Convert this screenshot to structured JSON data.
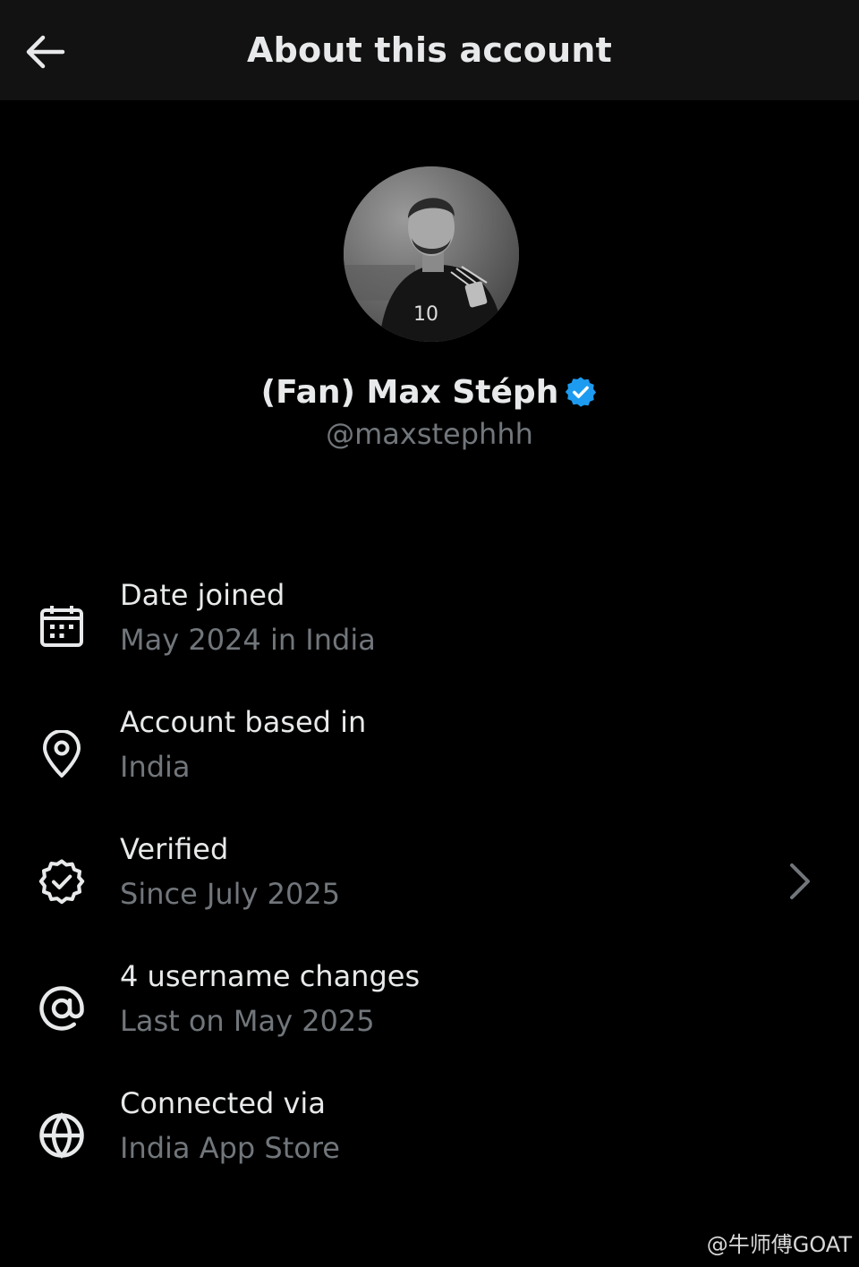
{
  "header": {
    "title": "About this account",
    "back_icon": "arrow-left-icon"
  },
  "profile": {
    "display_name": "(Fan) Max Stéph",
    "handle": "@maxstephhh",
    "verified_badge_color": "#1d9bf0"
  },
  "rows": [
    {
      "icon": "calendar-icon",
      "title": "Date joined",
      "subtitle": "May 2024 in India"
    },
    {
      "icon": "location-pin-icon",
      "title": "Account based in",
      "subtitle": "India"
    },
    {
      "icon": "verified-badge-icon",
      "title": "Verified",
      "subtitle": "Since July 2025",
      "has_chevron": true
    },
    {
      "icon": "at-sign-icon",
      "title": "4 username changes",
      "subtitle": "Last on May 2025"
    },
    {
      "icon": "globe-icon",
      "title": "Connected via",
      "subtitle": "India App Store"
    }
  ],
  "watermark": "@牛师傅GOAT",
  "colors": {
    "background": "#000000",
    "header_background": "#121212",
    "primary_text": "#e7e9ea",
    "secondary_text": "#71767b",
    "accent": "#1d9bf0"
  }
}
